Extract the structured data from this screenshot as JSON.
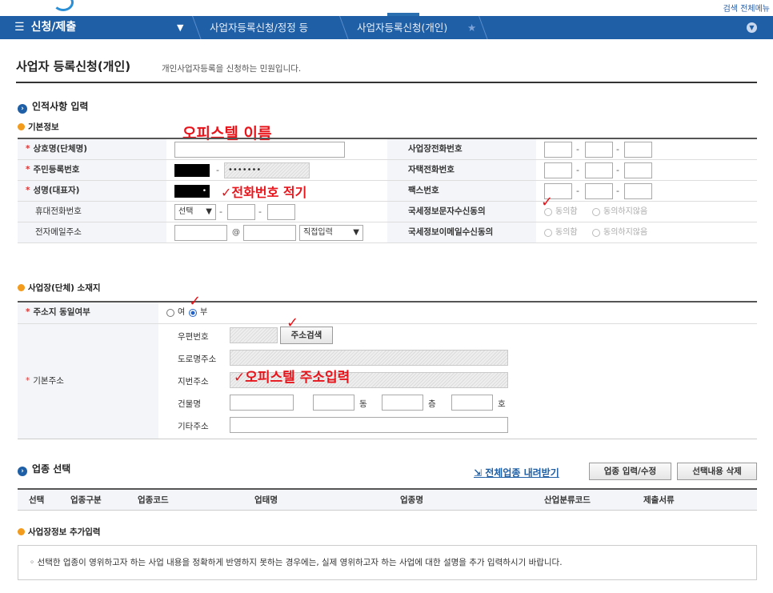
{
  "header": {
    "top_links": "검색   전체메뉴"
  },
  "nav": {
    "menu_label": "신청/제출",
    "breadcrumbs": [
      "사업자등록신청/정정 등",
      "사업자등록신청(개인)"
    ]
  },
  "page": {
    "title": "사업자 등록신청(개인)",
    "description": "개인사업자등록을 신청하는 민원입니다."
  },
  "sections": {
    "personal": "인적사항 입력",
    "basic": "기본정보",
    "location": "사업장(단체) 소재지",
    "industry": "업종 선택",
    "extra": "사업장정보 추가입력"
  },
  "annotations": {
    "officetel_name": "오피스텔 이름",
    "phone_note": "✓전화번호 적기",
    "address_note": "✓오피스텔 주소입력",
    "checks": [
      "✓",
      "✓",
      "✓"
    ]
  },
  "form": {
    "labels": {
      "trade_name": "상호명(단체명)",
      "resident_no": "주민등록번호",
      "rep_name": "성명(대표자)",
      "mobile": "휴대전화번호",
      "email": "전자메일주소",
      "biz_phone": "사업장전화번호",
      "home_phone": "자택전화번호",
      "fax": "팩스번호",
      "sms_consent": "국세정보문자수신동의",
      "email_consent": "국세정보이메일수신동의"
    },
    "resident_masked": "•••••••",
    "rep_name_dot": "•",
    "mobile_select": "선택",
    "email_at": "@",
    "email_domain_select": "직접입력",
    "agree": "동의함",
    "disagree": "동의하지않음",
    "dash": "-"
  },
  "address": {
    "same_label": "주소지 동일여부",
    "yes": "여",
    "no": "부",
    "base_label": "기본주소",
    "zip_label": "우편번호",
    "search_button": "주소검색",
    "road_label": "도로명주소",
    "lot_label": "지번주소",
    "building_label": "건물명",
    "dong": "동",
    "floor": "층",
    "ho": "호",
    "other_label": "기타주소"
  },
  "industry": {
    "download_link": "전체업종 내려받기",
    "edit_button": "업종 입력/수정",
    "delete_button": "선택내용 삭제",
    "columns": [
      "선택",
      "업종구분",
      "업종코드",
      "업태명",
      "업종명",
      "산업분류코드",
      "제출서류"
    ]
  },
  "extra_info": "◦ 선택한 업종이 영위하고자 하는 사업 내용을 정확하게 반영하지 못하는 경우에는, 실제 영위하고자 하는 사업에 대한 설명을 추가 입력하시기 바랍니다.",
  "colors": {
    "nav_bg": "#1f5fa6",
    "annotation": "#e8141b"
  }
}
